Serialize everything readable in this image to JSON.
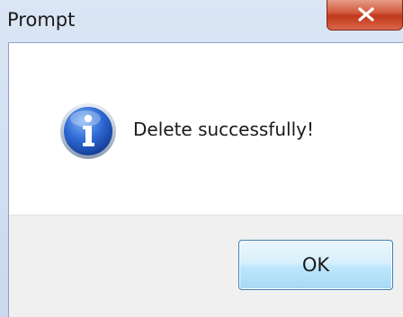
{
  "window": {
    "title": "Prompt"
  },
  "message": {
    "text": "Delete successfully!",
    "icon": "info-icon"
  },
  "buttons": {
    "ok_label": "OK",
    "close_icon": "close-icon"
  },
  "colors": {
    "close_button": "#c7442a",
    "ok_border": "#3c7fb1",
    "icon_blue": "#2a62c9"
  }
}
